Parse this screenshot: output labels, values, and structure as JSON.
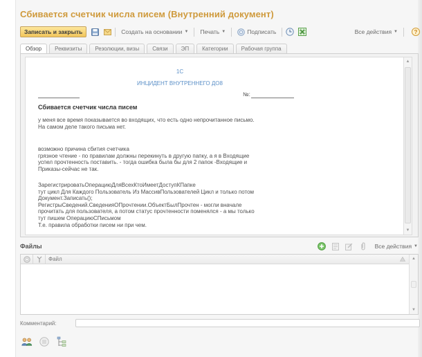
{
  "window": {
    "title": "Сбивается счетчик числа писем (Внутренний документ)"
  },
  "toolbar": {
    "save_close_label": "Записать и закрыть",
    "create_based_label": "Создать на основании",
    "print_label": "Печать",
    "sign_label": "Подписать",
    "all_actions_label": "Все действия",
    "help_label": "?"
  },
  "tabs": [
    {
      "label": "Обзор",
      "active": true
    },
    {
      "label": "Реквизиты",
      "active": false
    },
    {
      "label": "Резолюции, визы",
      "active": false
    },
    {
      "label": "Связи",
      "active": false
    },
    {
      "label": "ЭП",
      "active": false
    },
    {
      "label": "Категории",
      "active": false
    },
    {
      "label": "Рабочая группа",
      "active": false
    }
  ],
  "document": {
    "org": "1С",
    "header": "ИНЦИДЕНТ ВНУТРЕННЕГО ДО8",
    "number_label": "№:",
    "heading": "Сбивается счетчик числа писем",
    "paragraph1": [
      "у меня все время показывается во входящих, что есть одно непрочитанное письмо.",
      "На самом деле такого письма нет."
    ],
    "paragraph2": [
      "возможно причина сбития счетчика",
      "грязное чтение - по правилам должны перекинуть в другую папку, а я в Входящие",
      "успел прочтенность поставить. - тогда ошибка была бы для 2 папок -Входящие и",
      "Приказы-сейчас не так."
    ],
    "paragraph3": [
      "ЗарегистрироватьОперациюДляВсехКтоИмеетДоступКПапке",
      "тут цикл Для Каждого Пользователь Из МассивПользователей Цикл и только потом",
      "Документ.Записать();",
      "РегистрыСведений.СведенияОПрочтении.ОбъектБылПрочтен - могли вначале",
      "прочитать для пользователя, а потом статус прочтенности поменялся - а мы только",
      "тут пишем ОперациюСПисьмом",
      "Т.е. правила обработки писем ни при чем."
    ]
  },
  "files": {
    "title": "Файлы",
    "all_actions_label": "Все действия",
    "columns": [
      "Файл"
    ],
    "rows": []
  },
  "comment": {
    "label": "Комментарий:",
    "value": ""
  },
  "icons": {
    "save": "floppy-disk-icon",
    "mail": "envelope-icon",
    "sign": "sign-icon",
    "history": "clock-icon",
    "excel": "spreadsheet-icon",
    "help": "help-icon",
    "add_file": "add-file-icon",
    "users": "users-icon",
    "structure": "structure-icon"
  },
  "colors": {
    "title": "#cf9a3c",
    "primary_button": "#f2c55b",
    "doc_link": "#5b8fc7",
    "add_green": "#5cb85c"
  }
}
